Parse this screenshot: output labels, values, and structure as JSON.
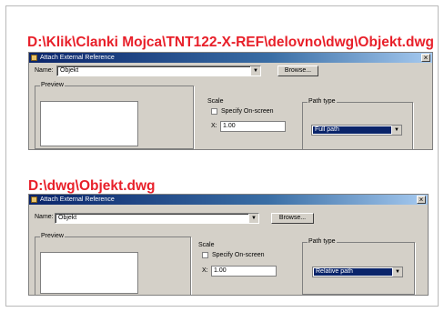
{
  "captions": {
    "path1": "D:\\Klik\\Clanki Mojca\\TNT122-X-REF\\delovno\\dwg\\Objekt.dwg",
    "path2": "D:\\dwg\\Objekt.dwg"
  },
  "dialogs": [
    {
      "title": "Attach External Reference",
      "name_label": "Name:",
      "name_value": "Objekt",
      "browse_label": "Browse...",
      "preview_label": "Preview",
      "scale_label": "Scale",
      "specify_label": "Specify On-screen",
      "x_label": "X:",
      "x_value": "1.00",
      "path_type_label": "Path type",
      "path_type_value": "Full path",
      "close": "×"
    },
    {
      "title": "Attach External Reference",
      "name_label": "Name:",
      "name_value": "Objekt",
      "browse_label": "Browse...",
      "preview_label": "Preview",
      "scale_label": "Scale",
      "specify_label": "Specify On-screen",
      "x_label": "X:",
      "x_value": "1.00",
      "path_type_label": "Path type",
      "path_type_value": "Relative path",
      "close": "×"
    }
  ],
  "colors": {
    "caption": "#e8202a",
    "dialog_bg": "#d4d0c8",
    "titlebar": "#0a246a",
    "selection": "#0a246a"
  }
}
